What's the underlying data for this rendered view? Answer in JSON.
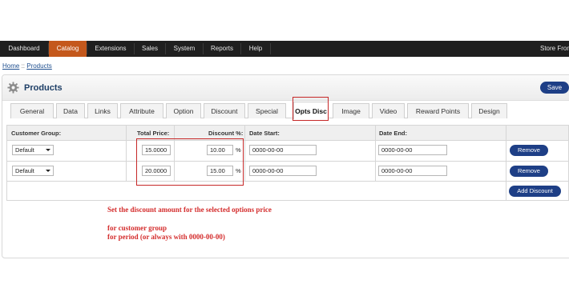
{
  "menu": {
    "items": [
      {
        "label": "Dashboard",
        "active": false
      },
      {
        "label": "Catalog",
        "active": true
      },
      {
        "label": "Extensions",
        "active": false
      },
      {
        "label": "Sales",
        "active": false
      },
      {
        "label": "System",
        "active": false
      },
      {
        "label": "Reports",
        "active": false
      },
      {
        "label": "Help",
        "active": false
      }
    ],
    "store_front": "Store Fron"
  },
  "breadcrumb": {
    "home": "Home",
    "separator": " :: ",
    "current": "Products"
  },
  "header": {
    "title": "Products",
    "save_label": "Save",
    "icon": "gear-icon"
  },
  "tabs": [
    "General",
    "Data",
    "Links",
    "Attribute",
    "Option",
    "Discount",
    "Special",
    "Opts Disc",
    "Image",
    "Video",
    "Reward Points",
    "Design"
  ],
  "active_tab": "Opts Disc",
  "table": {
    "columns": [
      "Customer Group:",
      "Total Price:",
      "Discount %:",
      "Date Start:",
      "Date End:"
    ],
    "rows": [
      {
        "customer_group": "Default",
        "total_price": "15.0000",
        "discount": "10.00",
        "percent_sign": "%",
        "date_start": "0000-00-00",
        "date_end": "0000-00-00",
        "remove_label": "Remove"
      },
      {
        "customer_group": "Default",
        "total_price": "20.0000",
        "discount": "15.00",
        "percent_sign": "%",
        "date_start": "0000-00-00",
        "date_end": "0000-00-00",
        "remove_label": "Remove"
      }
    ],
    "add_label": "Add Discount"
  },
  "notes": {
    "line1": "Set the discount amount for the selected options price",
    "line2": "for customer group",
    "line3": "for period (or always with 0000-00-00)"
  },
  "colors": {
    "menu_bg": "#1f1f1f",
    "active_menu": "#c4581c",
    "button": "#1e3f86",
    "annotation": "#d42e2e",
    "title": "#1d3e66"
  }
}
